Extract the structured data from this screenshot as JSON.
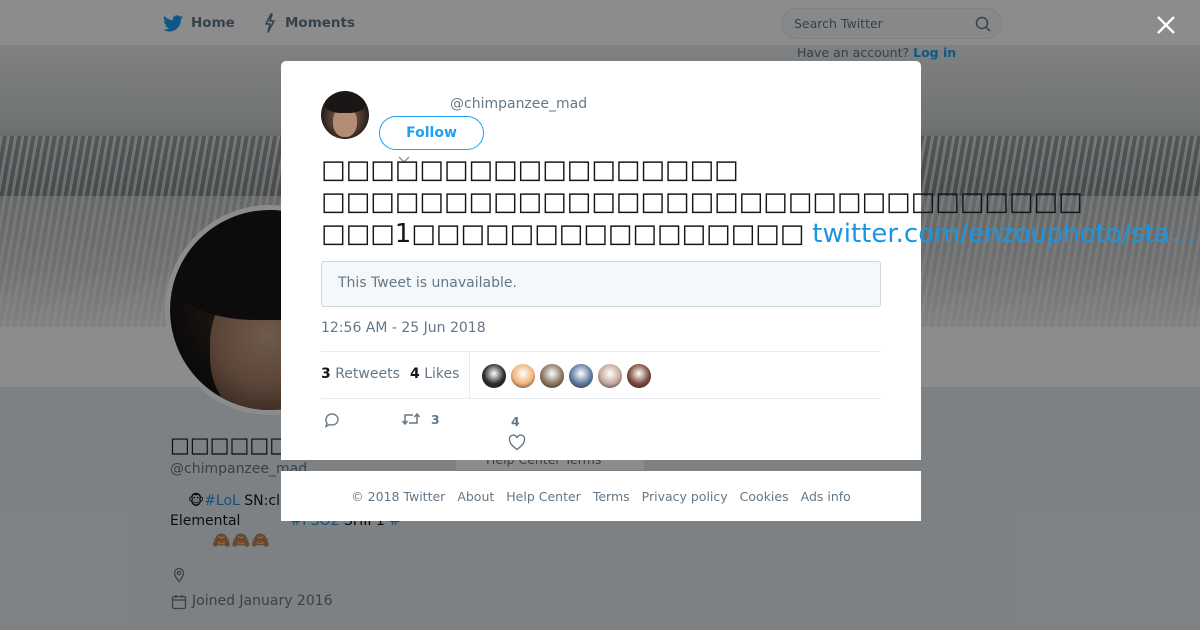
{
  "topbar": {
    "home_label": "Home",
    "moments_label": "Moments",
    "search_placeholder": "Search Twitter",
    "have_account": "Have an account?",
    "login": "Log in"
  },
  "profile": {
    "name": "□□□□□□□□□□□□",
    "handle": "@chimpanzee_mad",
    "bio": {
      "emoji1": "🐵",
      "tag_lol": "#LoL",
      "text1": " SN:cl",
      "text2": "Elemental",
      "tag_pso2": "#PSO2",
      "text3": " SHIP1 ",
      "tag_hash": "#",
      "emoji_row": "🙈🙈🙈"
    },
    "joined": "Joined January 2016",
    "help_center_peek": "Help Center   Terms"
  },
  "tweet": {
    "author_handle": "@chimpanzee_mad",
    "follow_label": "Follow",
    "text_line1": "□□□□□□□□□□□□□□□□□",
    "text_line2": "□□□□□□□□□□□□□□□□□□□□□□□□□□□□□□□",
    "text_line3": "□□□1□□□□□□□□□□□□□□□□",
    "link_text": "twitter.com/enzouphoto/sta…",
    "quoted_unavailable": "This Tweet is unavailable.",
    "timestamp": "12:56 AM - 25 Jun 2018",
    "retweets_count": "3",
    "retweets_label": "Retweets",
    "likes_count": "4",
    "likes_label": "Likes",
    "action_retweet_count": "3",
    "action_like_count": "4",
    "liker_colors": [
      "#2b2b2b",
      "#f2b27a",
      "#8a7560",
      "#5c7aa0",
      "#c4a89a",
      "#7a4a3a"
    ]
  },
  "footer": {
    "copyright": "© 2018 Twitter",
    "about": "About",
    "help_center": "Help Center",
    "terms": "Terms",
    "privacy": "Privacy policy",
    "cookies": "Cookies",
    "ads": "Ads info"
  },
  "colors": {
    "accent": "#1da1f2",
    "link": "#1b95e0",
    "secondary_text": "#657786"
  }
}
